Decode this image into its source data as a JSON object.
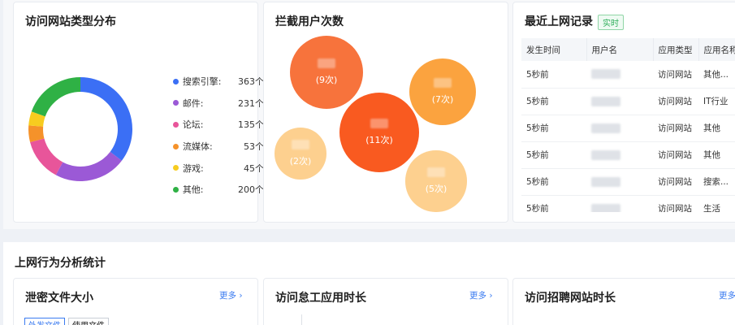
{
  "cards": {
    "site_types": {
      "title": "访问网站类型分布"
    },
    "blocked": {
      "title": "拦截用户次数"
    },
    "recent": {
      "title": "最近上网记录",
      "badge": "实时"
    }
  },
  "chart_data": [
    {
      "type": "pie",
      "title": "访问网站类型分布",
      "labels": [
        "搜索引擎:",
        "邮件:",
        "论坛:",
        "流媒体:",
        "游戏:",
        "其他:"
      ],
      "display_values": [
        "363个",
        "231个",
        "135个",
        "53个",
        "45个",
        "200个"
      ],
      "values": [
        363,
        231,
        135,
        53,
        45,
        200
      ],
      "colors": [
        "#3b6ff5",
        "#9b59d6",
        "#e8559a",
        "#f5922a",
        "#f7cc1f",
        "#2fb145"
      ],
      "donut": true
    },
    {
      "type": "scatter",
      "title": "拦截用户次数",
      "labels": [
        "(9次)",
        "(7次)",
        "(11次)",
        "(2次)",
        "(5次)"
      ],
      "values": [
        9,
        7,
        11,
        2,
        5
      ],
      "colors": [
        "#f7733c",
        "#fba33f",
        "#f95a20",
        "#fdd08f",
        "#fdd08f"
      ]
    }
  ],
  "recent": {
    "columns": [
      "发生时间",
      "用户名",
      "应用类型",
      "应用名称"
    ],
    "rows": [
      {
        "time": "5秒前",
        "type": "访问网站",
        "app": "其他..."
      },
      {
        "time": "5秒前",
        "type": "访问网站",
        "app": "IT行业"
      },
      {
        "time": "5秒前",
        "type": "访问网站",
        "app": "其他"
      },
      {
        "time": "5秒前",
        "type": "访问网站",
        "app": "其他"
      },
      {
        "time": "5秒前",
        "type": "访问网站",
        "app": "搜索..."
      },
      {
        "time": "5秒前",
        "type": "访问网站",
        "app": "生活"
      }
    ]
  },
  "section": {
    "title": "上网行为分析统计"
  },
  "bottom_cards": [
    {
      "title": "泄密文件大小",
      "more": "更多 ›"
    },
    {
      "title": "访问怠工应用时长",
      "more": "更多 ›"
    },
    {
      "title": "访问招聘网站时长",
      "more": "更多"
    }
  ],
  "tabs": [
    "外发文件",
    "使用文件"
  ]
}
